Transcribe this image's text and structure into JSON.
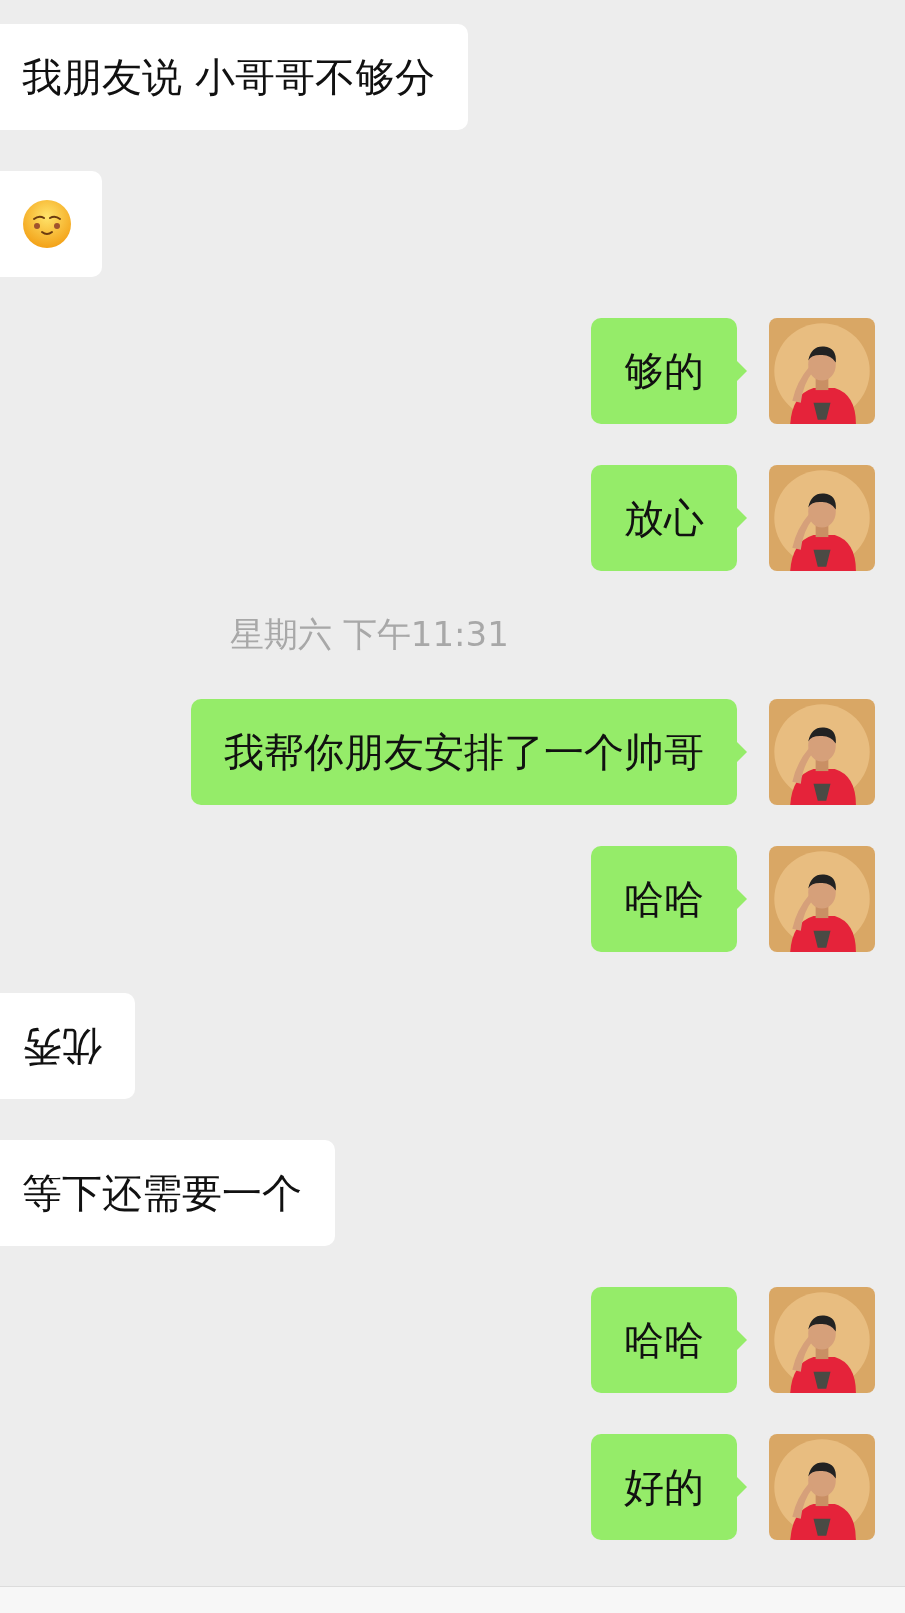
{
  "messages": [
    {
      "kind": "text",
      "sent": false,
      "text": "我朋友说 小哥哥不够分",
      "rotated": false
    },
    {
      "kind": "emoji",
      "sent": false
    },
    {
      "kind": "text",
      "sent": true,
      "text": "够的",
      "rotated": false
    },
    {
      "kind": "text",
      "sent": true,
      "text": "放心",
      "rotated": false
    },
    {
      "kind": "time",
      "text": "星期六 下午11:31"
    },
    {
      "kind": "text",
      "sent": true,
      "text": "我帮你朋友安排了一个帅哥",
      "rotated": false
    },
    {
      "kind": "text",
      "sent": true,
      "text": "哈哈",
      "rotated": false
    },
    {
      "kind": "text",
      "sent": false,
      "text": "优秀",
      "rotated": true
    },
    {
      "kind": "text",
      "sent": false,
      "text": "等下还需要一个",
      "rotated": false
    },
    {
      "kind": "text",
      "sent": true,
      "text": "哈哈",
      "rotated": false
    },
    {
      "kind": "text",
      "sent": true,
      "text": "好的",
      "rotated": false
    }
  ]
}
